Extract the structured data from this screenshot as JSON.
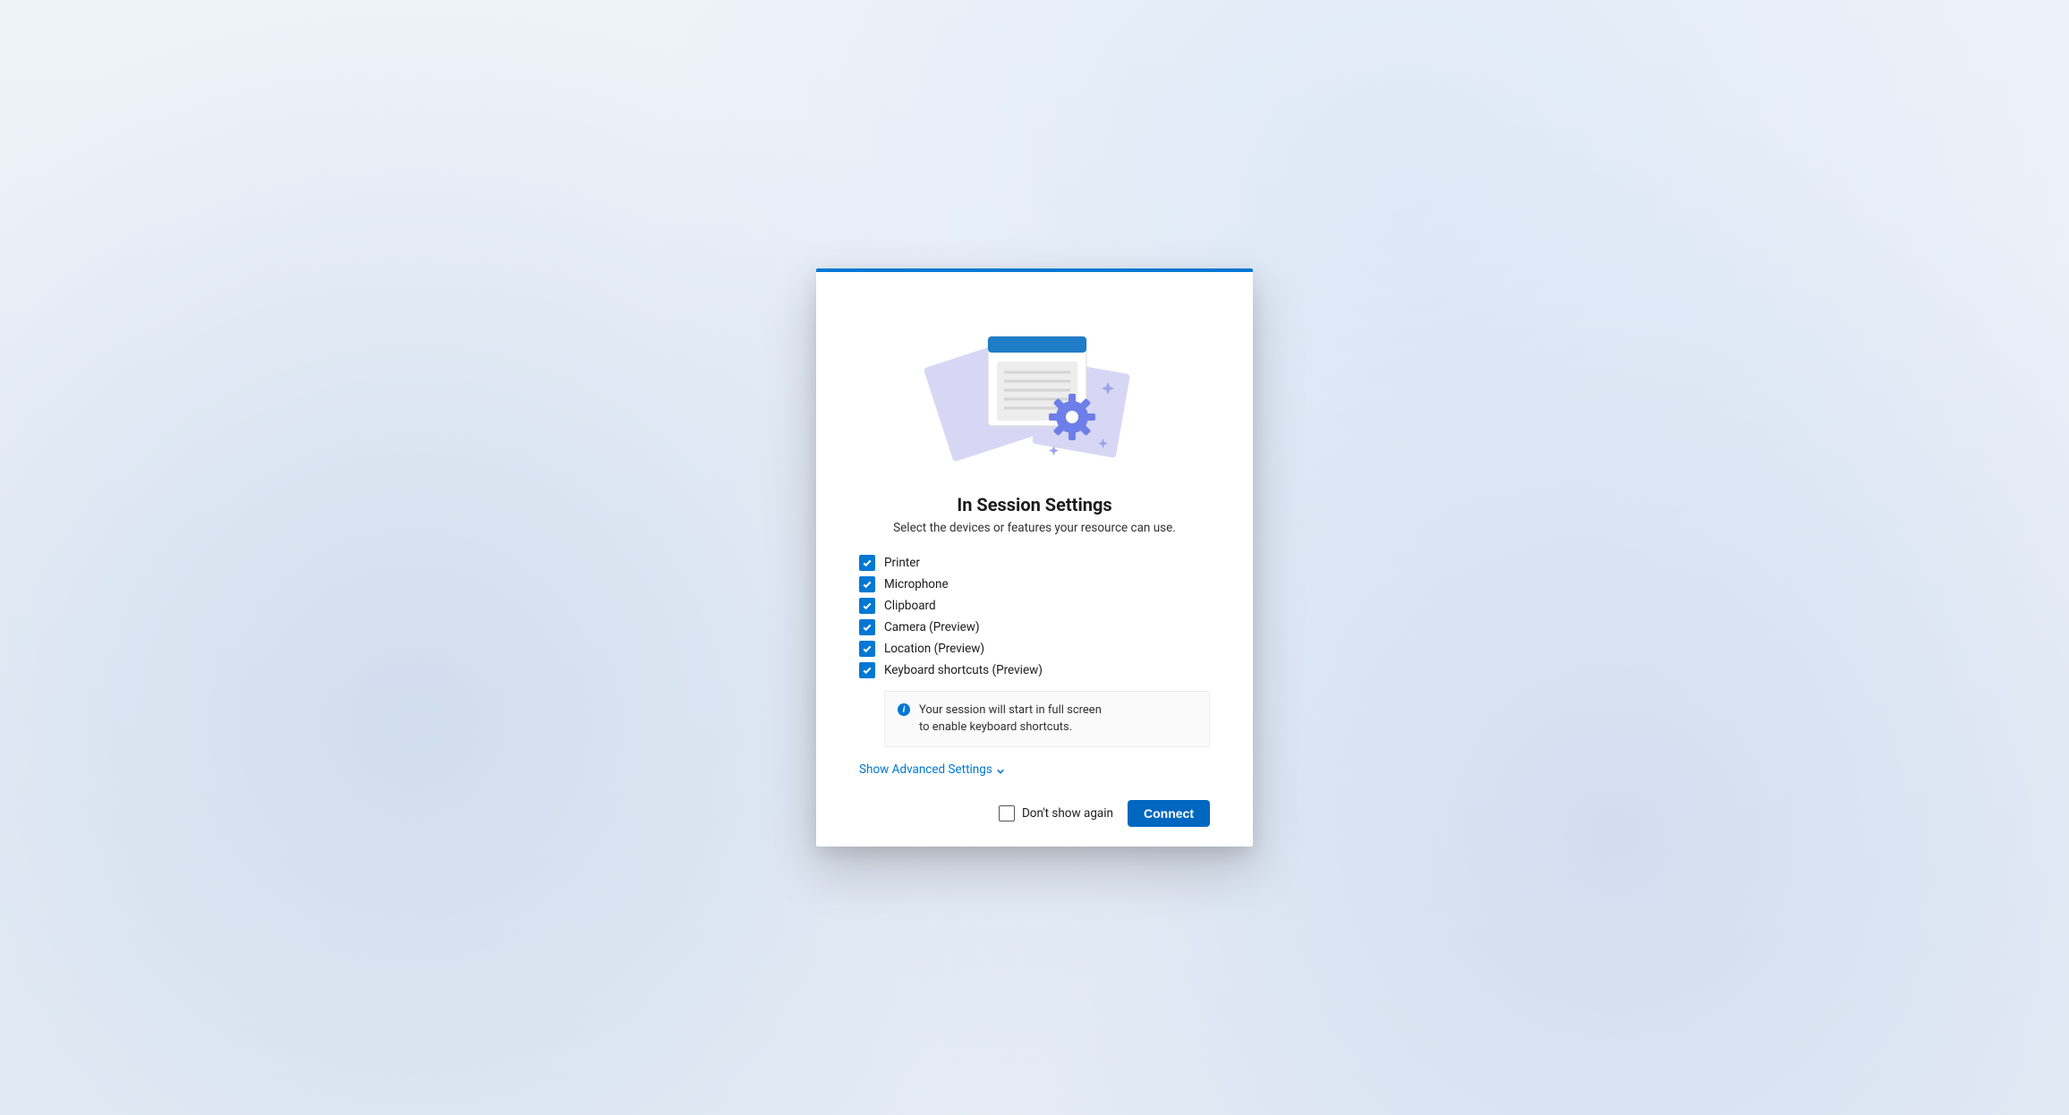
{
  "dialog": {
    "title": "In Session Settings",
    "subtitle": "Select the devices or features your resource can use.",
    "options": [
      {
        "label": "Printer",
        "checked": true
      },
      {
        "label": "Microphone",
        "checked": true
      },
      {
        "label": "Clipboard",
        "checked": true
      },
      {
        "label": "Camera (Preview)",
        "checked": true
      },
      {
        "label": "Location (Preview)",
        "checked": true
      },
      {
        "label": "Keyboard shortcuts (Preview)",
        "checked": true
      }
    ],
    "info_text": "Your session will start in full screen to enable keyboard shortcuts.",
    "advanced_label": "Show Advanced Settings",
    "dont_show_label": "Don't show again",
    "dont_show_checked": false,
    "connect_label": "Connect"
  }
}
